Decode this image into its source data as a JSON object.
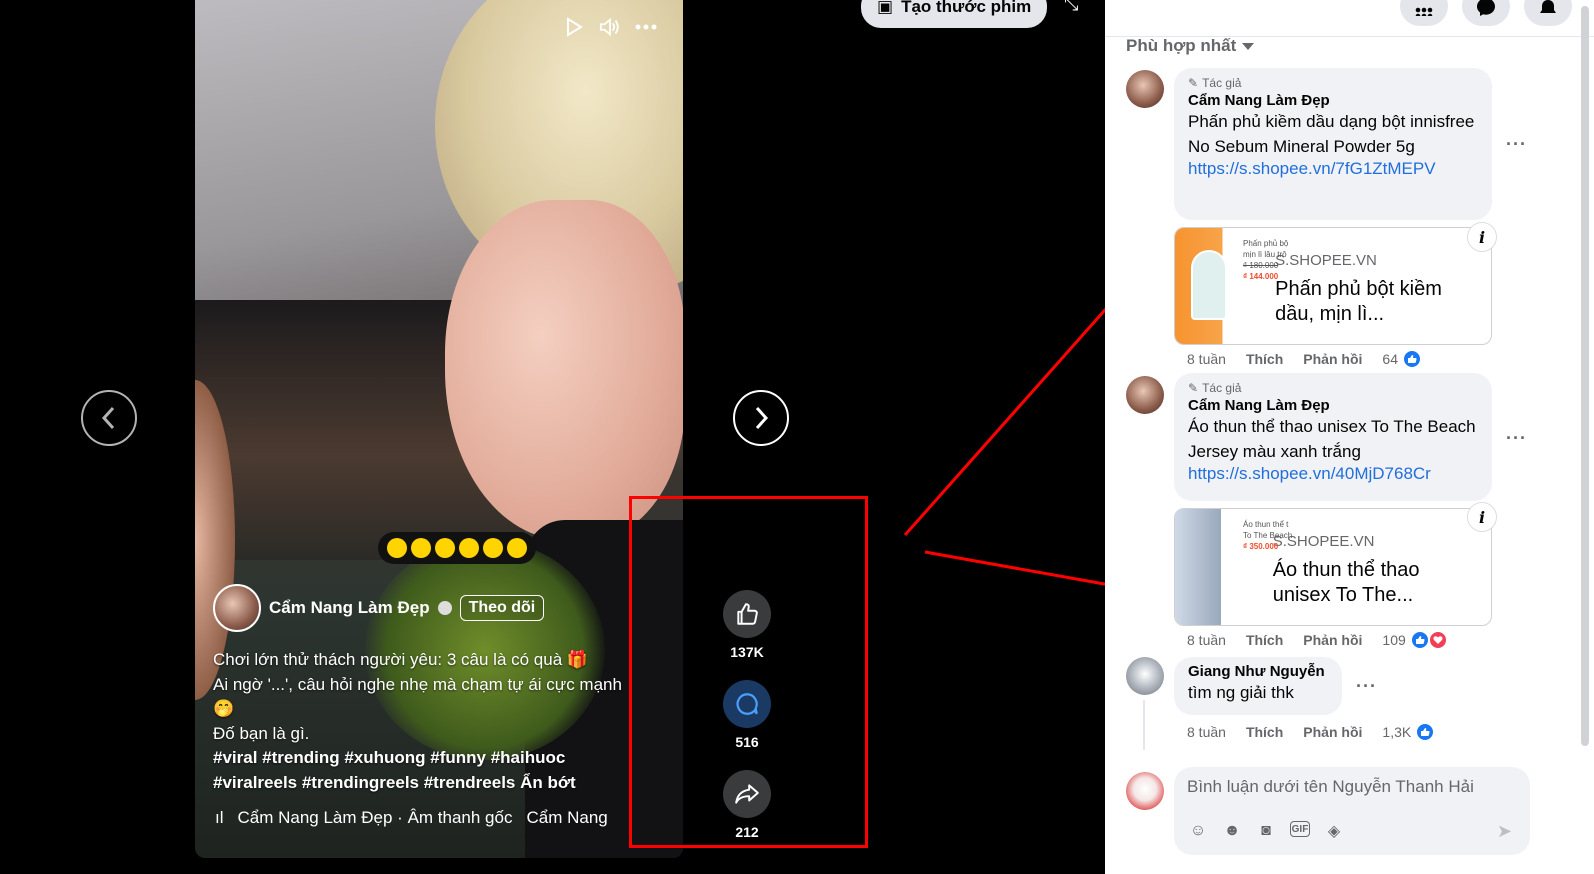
{
  "video": {
    "author": "Cẩm Nang Làm Đẹp",
    "follow": "Theo dõi",
    "caption_lines": [
      "Chơi lớn thử thách người yêu: 3 câu là có quà 🎁",
      "Ai ngờ '...', câu hỏi nghe nhẹ mà chạm tự ái cực mạnh",
      "🤭",
      "Đố bạn là gì."
    ],
    "tags_line1": "#viral #trending #xuhuong #funny #haihuoc",
    "tags_line2": "#viralreels #trendingreels #trendreels",
    "see_less": "Ẩn bớt",
    "audio": "Cẩm Nang Làm Đẹp · Âm thanh gốc",
    "audio2": "Cẩm Nang",
    "likes": "137K",
    "comments": "516",
    "shares": "212",
    "create_reel": "Tạo thước phim"
  },
  "panel": {
    "sort_label": "Phù hợp nhất",
    "comments": [
      {
        "badge": "Tác giả",
        "name": "Cẩm Nang Làm Đẹp",
        "text": "Phấn phủ kiềm dầu dạng bột innisfree No Sebum Mineral Powder 5g",
        "link": "https://s.shopee.vn/7fG1ZtMEPV",
        "card_domain": "S.SHOPEE.VN",
        "card_title": "Phấn phủ bột kiềm dầu, mịn lì...",
        "thumb_text": "Phấn phủ bộ mịn lì lâu trô",
        "thumb_old_price": "₫ 180.000",
        "thumb_price": "₫ 144.000",
        "time": "8 tuần",
        "like": "Thích",
        "reply": "Phản hồi",
        "count": "64"
      },
      {
        "badge": "Tác giả",
        "name": "Cẩm Nang Làm Đẹp",
        "text": "Áo thun thể thao unisex To The Beach Jersey màu xanh trắng",
        "link": "https://s.shopee.vn/40MjD768Cr",
        "card_domain": "S.SHOPEE.VN",
        "card_title": "Áo thun thể thao unisex To The...",
        "thumb_text": "Áo thun thể t To The Beach",
        "thumb_price": "₫ 350.000",
        "time": "8 tuần",
        "like": "Thích",
        "reply": "Phản hồi",
        "count": "109"
      },
      {
        "name": "Giang Như Nguyễn",
        "text": "tìm ng giải thk",
        "time": "8 tuần",
        "like": "Thích",
        "reply": "Phản hồi",
        "count": "1,3K"
      }
    ],
    "composer_placeholder": "Bình luận dưới tên Nguyễn Thanh Hải"
  },
  "colors": {
    "annotation": "#ff0000",
    "link": "#216fdb",
    "like": "#1877f2"
  }
}
